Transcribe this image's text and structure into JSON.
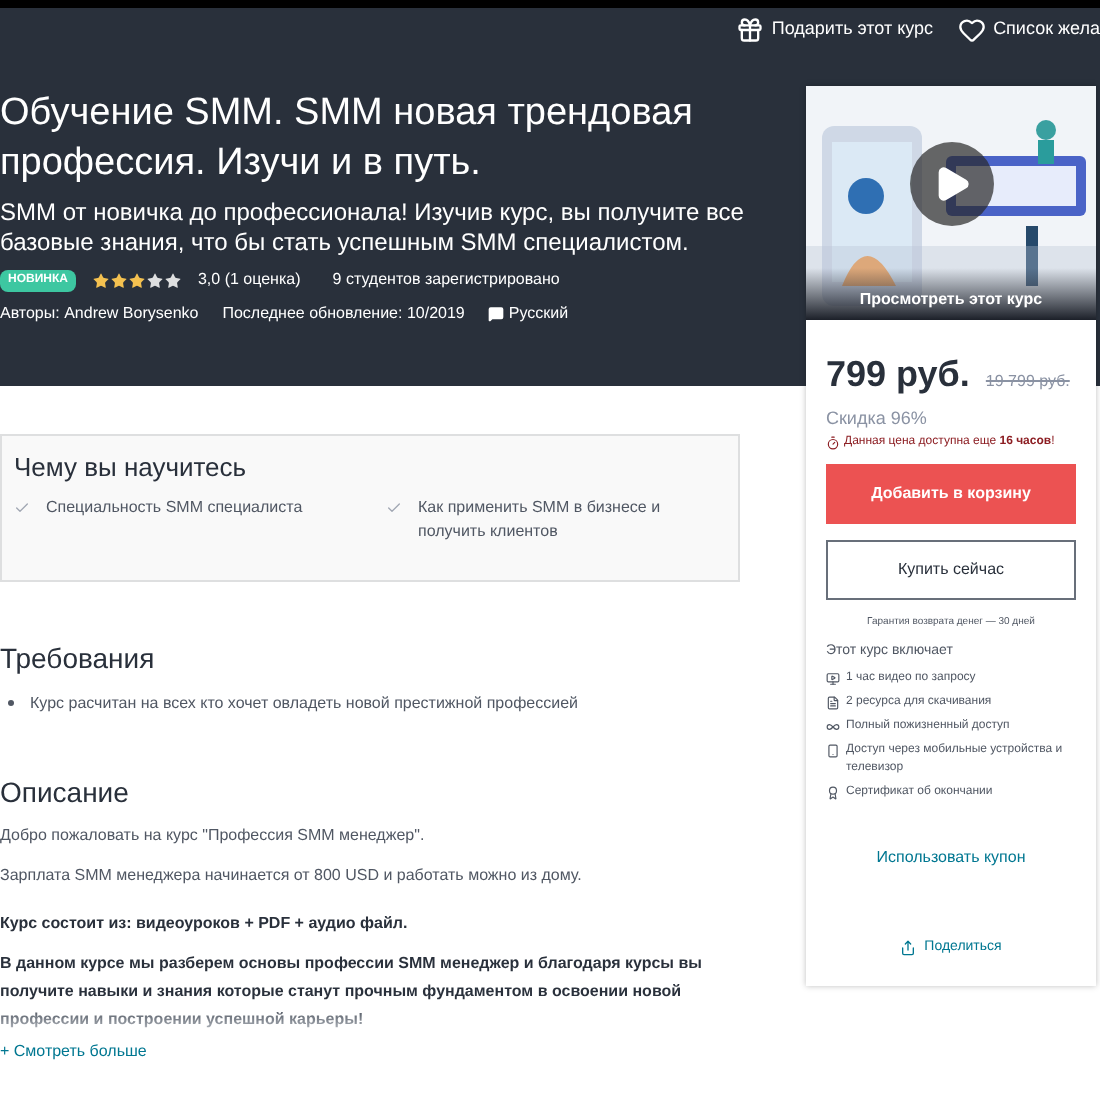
{
  "top_actions": [
    {
      "kind": "gift",
      "label": "Подарить этот курс"
    },
    {
      "kind": "heart",
      "label": "Список жела"
    }
  ],
  "course": {
    "title": "Обучение SMM. SMM новая трендовая профессия. Изучи и в путь.",
    "subtitle": "SMM от новичка до профессионала! Изучив курс, вы получите все базовые знания, что бы стать успешным SMM специалистом.",
    "badge": "НОВИНКА",
    "stars": 3,
    "rating": "3,0 (1 оценка)",
    "students": "9 студентов зарегистрировано",
    "authors": "Авторы: Andrew Borysenko",
    "updated": "Последнее обновление: 10/2019",
    "language": "Русский"
  },
  "learn": {
    "heading": "Чему вы научитесь",
    "items": [
      "Специальность SMM специалиста",
      "Как применить SMM в бизнесе и получить клиентов"
    ]
  },
  "requirements": {
    "heading": "Требования",
    "items": [
      "Курс расчитан на всех кто хочет овладеть новой престижной профессией"
    ]
  },
  "description": {
    "heading": "Описание",
    "paragraphs": [
      {
        "text": "Добро пожаловать на курс \"Профессия SMM менеджер\".",
        "bold": false
      },
      {
        "text": "Зарплата SMM менеджера начинается от 800 USD и работать можно из дому.",
        "bold": false
      },
      {
        "text": "Курс состоит из: видеоуроков + PDF + аудио файл.",
        "bold": true
      },
      {
        "text": "В данном курсе мы разберем основы профессии SMM менеджер и благодаря курсы вы получите навыки и знания которые станут прочным фундаментом в освоении новой профессии и построении успешной карьеры!",
        "bold": true
      }
    ],
    "more": "+ Смотреть больше"
  },
  "card": {
    "preview": {
      "kind": "picture",
      "caption": "Просмотреть этот курс"
    },
    "price": "799 руб.",
    "old_price": "19 799 руб.",
    "discount": "Скидка 96%",
    "timer": "Данная цена доступна еще **16 часов**!",
    "add_to_cart": "Добавить в корзину",
    "buy_now": "Купить сейчас",
    "guarantee": "Гарантия возврата денег — 30 дней",
    "includes_heading": "Этот курс включает",
    "includes": [
      {
        "kind": "video",
        "text": "1 час видео по запросу"
      },
      {
        "kind": "file",
        "text": "2 ресурса для скачивания"
      },
      {
        "kind": "infinity",
        "text": "Полный пожизненный доступ"
      },
      {
        "kind": "mobile",
        "text": "Доступ через мобильные устройства и телевизор"
      },
      {
        "kind": "certificate",
        "text": "Сертификат об окончании"
      }
    ],
    "coupon": "Использовать купон",
    "share": "Поделиться"
  }
}
